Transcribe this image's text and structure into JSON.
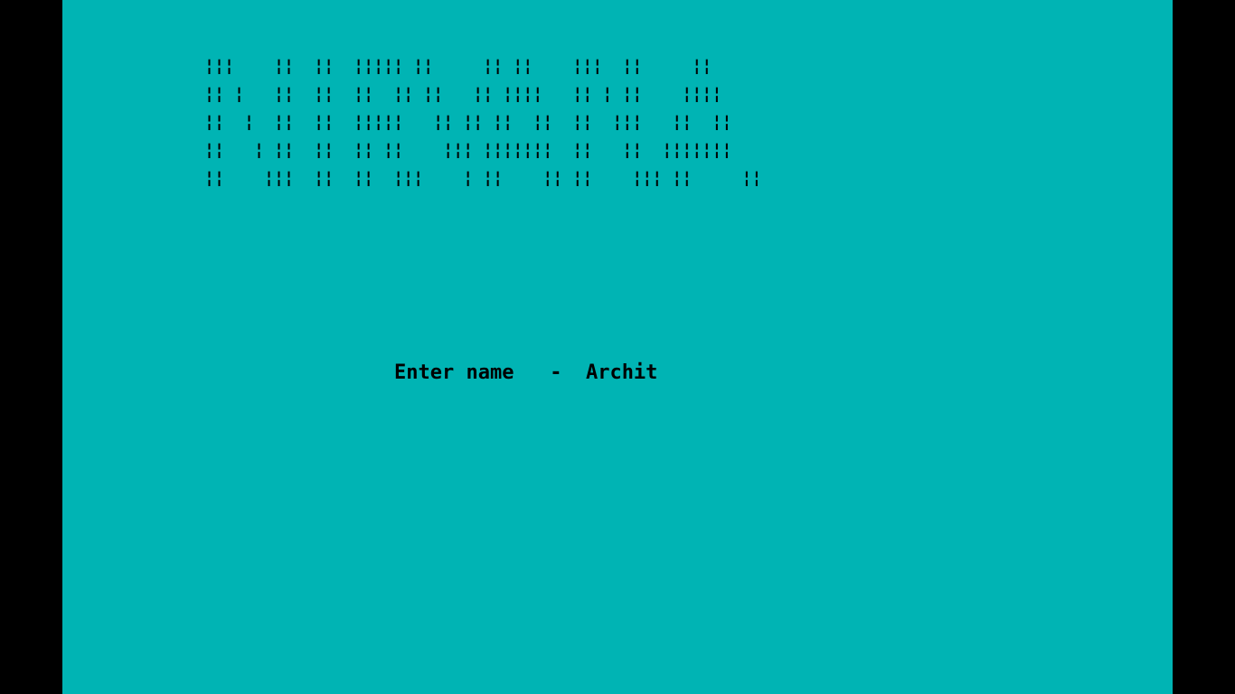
{
  "colors": {
    "background": "#00b4b4",
    "border": "#000000",
    "text": "#000000"
  },
  "banner": {
    "ascii_art_word": "NIRVANA",
    "lines": [
      "¦¦¦    ¦¦  ¦¦  ¦¦¦¦¦ ¦¦     ¦¦ ¦¦    ¦¦¦  ¦¦     ¦¦",
      "¦¦ ¦   ¦¦  ¦¦  ¦¦  ¦¦ ¦¦   ¦¦ ¦¦¦¦   ¦¦ ¦ ¦¦    ¦¦¦¦",
      "¦¦  ¦  ¦¦  ¦¦  ¦¦¦¦¦   ¦¦ ¦¦ ¦¦  ¦¦  ¦¦  ¦¦¦   ¦¦  ¦¦",
      "¦¦   ¦ ¦¦  ¦¦  ¦¦ ¦¦    ¦¦¦ ¦¦¦¦¦¦¦  ¦¦   ¦¦  ¦¦¦¦¦¦¦",
      "¦¦    ¦¦¦  ¦¦  ¦¦  ¦¦¦    ¦ ¦¦    ¦¦ ¦¦    ¦¦¦ ¦¦     ¦¦"
    ]
  },
  "prompt": {
    "label": "Enter name",
    "separator": "-",
    "value": "Archit"
  }
}
